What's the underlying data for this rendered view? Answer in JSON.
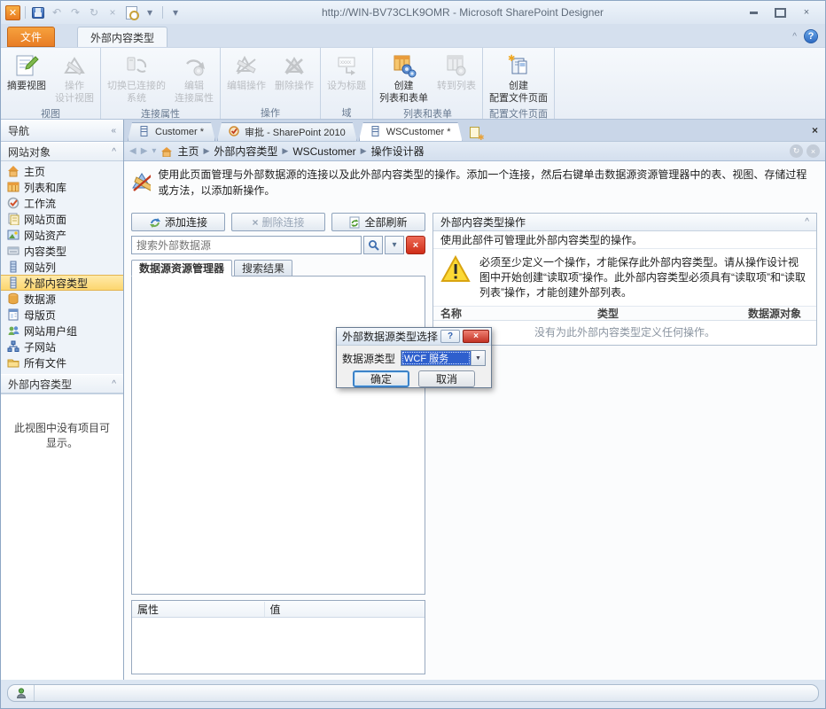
{
  "window": {
    "title": "http://WIN-BV73CLK9OMR  -  Microsoft SharePoint Designer"
  },
  "icons": {
    "app": "✕",
    "undo": "↶",
    "redo": "↷",
    "refresh": "↻",
    "stop": "×",
    "dropdown": "▾",
    "help": "?",
    "collapse_left": "«",
    "collapse_up": "^",
    "close": "×",
    "back": "◀",
    "forward": "▶",
    "crumb_sep": "▶",
    "combo_arrow": "▼",
    "delete_x": "×",
    "star": "✱"
  },
  "ribbon": {
    "tabs": {
      "file": "文件",
      "context": "外部内容类型"
    },
    "groups": [
      {
        "label": "视图",
        "buttons": [
          {
            "l1": "摘要视图",
            "l2": ""
          },
          {
            "l1": "操作",
            "l2": "设计视图"
          }
        ]
      },
      {
        "label": "连接属性",
        "buttons": [
          {
            "l1": "切换已连接的",
            "l2": "系统"
          },
          {
            "l1": "编辑",
            "l2": "连接属性"
          }
        ]
      },
      {
        "label": "操作",
        "buttons": [
          {
            "l1": "编辑操作",
            "l2": ""
          },
          {
            "l1": "删除操作",
            "l2": ""
          }
        ]
      },
      {
        "label": "域",
        "buttons": [
          {
            "l1": "设为标题",
            "l2": ""
          }
        ]
      },
      {
        "label": "列表和表单",
        "buttons": [
          {
            "l1": "创建",
            "l2": "列表和表单"
          },
          {
            "l1": "转到列表",
            "l2": ""
          }
        ]
      },
      {
        "label": "配置文件页面",
        "buttons": [
          {
            "l1": "创建",
            "l2": "配置文件页面"
          }
        ]
      }
    ]
  },
  "nav": {
    "title": "导航",
    "sections": [
      {
        "label": "网站对象"
      },
      {
        "label": "外部内容类型"
      }
    ],
    "items": [
      "主页",
      "列表和库",
      "工作流",
      "网站页面",
      "网站资产",
      "内容类型",
      "网站列",
      "外部内容类型",
      "数据源",
      "母版页",
      "网站用户组",
      "子网站",
      "所有文件"
    ],
    "empty_text": "此视图中没有项目可显示。"
  },
  "doc_tabs": {
    "tabs": [
      "Customer *",
      "审批 - SharePoint 2010",
      "WSCustomer *"
    ]
  },
  "breadcrumb": {
    "items": [
      "主页",
      "外部内容类型",
      "WSCustomer",
      "操作设计器"
    ]
  },
  "page": {
    "description": "使用此页面管理与外部数据源的连接以及此外部内容类型的操作。添加一个连接，然后右键单击数据源资源管理器中的表、视图、存储过程或方法，以添加新操作。"
  },
  "connections": {
    "add_button": "添加连接",
    "remove_button": "删除连接",
    "refresh_button": "全部刷新",
    "search_placeholder": "搜索外部数据源",
    "tabs": [
      "数据源资源管理器",
      "搜索结果"
    ],
    "props_table": {
      "headers": [
        "属性",
        "值"
      ]
    }
  },
  "operations": {
    "title": "外部内容类型操作",
    "subtitle": "使用此部件可管理此外部内容类型的操作。",
    "warning": "必须至少定义一个操作，才能保存此外部内容类型。请从操作设计视图中开始创建“读取项”操作。此外部内容类型必须具有“读取项”和“读取列表”操作，才能创建外部列表。",
    "table": {
      "headers": [
        "名称",
        "类型",
        "数据源对象"
      ],
      "empty": "没有为此外部内容类型定义任何操作。"
    }
  },
  "dialog": {
    "title": "外部数据源类型选择",
    "label": "数据源类型",
    "selected": "WCF 服务",
    "ok": "确定",
    "cancel": "取消"
  }
}
